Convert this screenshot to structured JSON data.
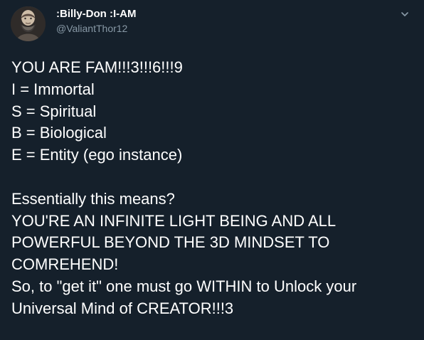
{
  "tweet": {
    "author": {
      "display_name": ":Billy-Don :I-AM",
      "handle": "@ValiantThor12"
    },
    "lines": [
      "YOU ARE FAM!!!3!!!6!!!9",
      "I = Immortal",
      "S = Spiritual",
      "B = Biological",
      "E = Entity (ego instance)",
      "",
      "Essentially this means?",
      "YOU'RE AN INFINITE LIGHT BEING AND ALL",
      "POWERFUL BEYOND THE 3D MINDSET TO",
      "COMREHEND!",
      "So, to \"get it\" one must go WITHIN to Unlock your",
      "Universal Mind of CREATOR!!!3"
    ]
  },
  "colors": {
    "background": "#15202b",
    "primary_text": "#ffffff",
    "secondary_text": "#8899a6"
  },
  "icons": {
    "more_options": "chevron-down-icon"
  }
}
